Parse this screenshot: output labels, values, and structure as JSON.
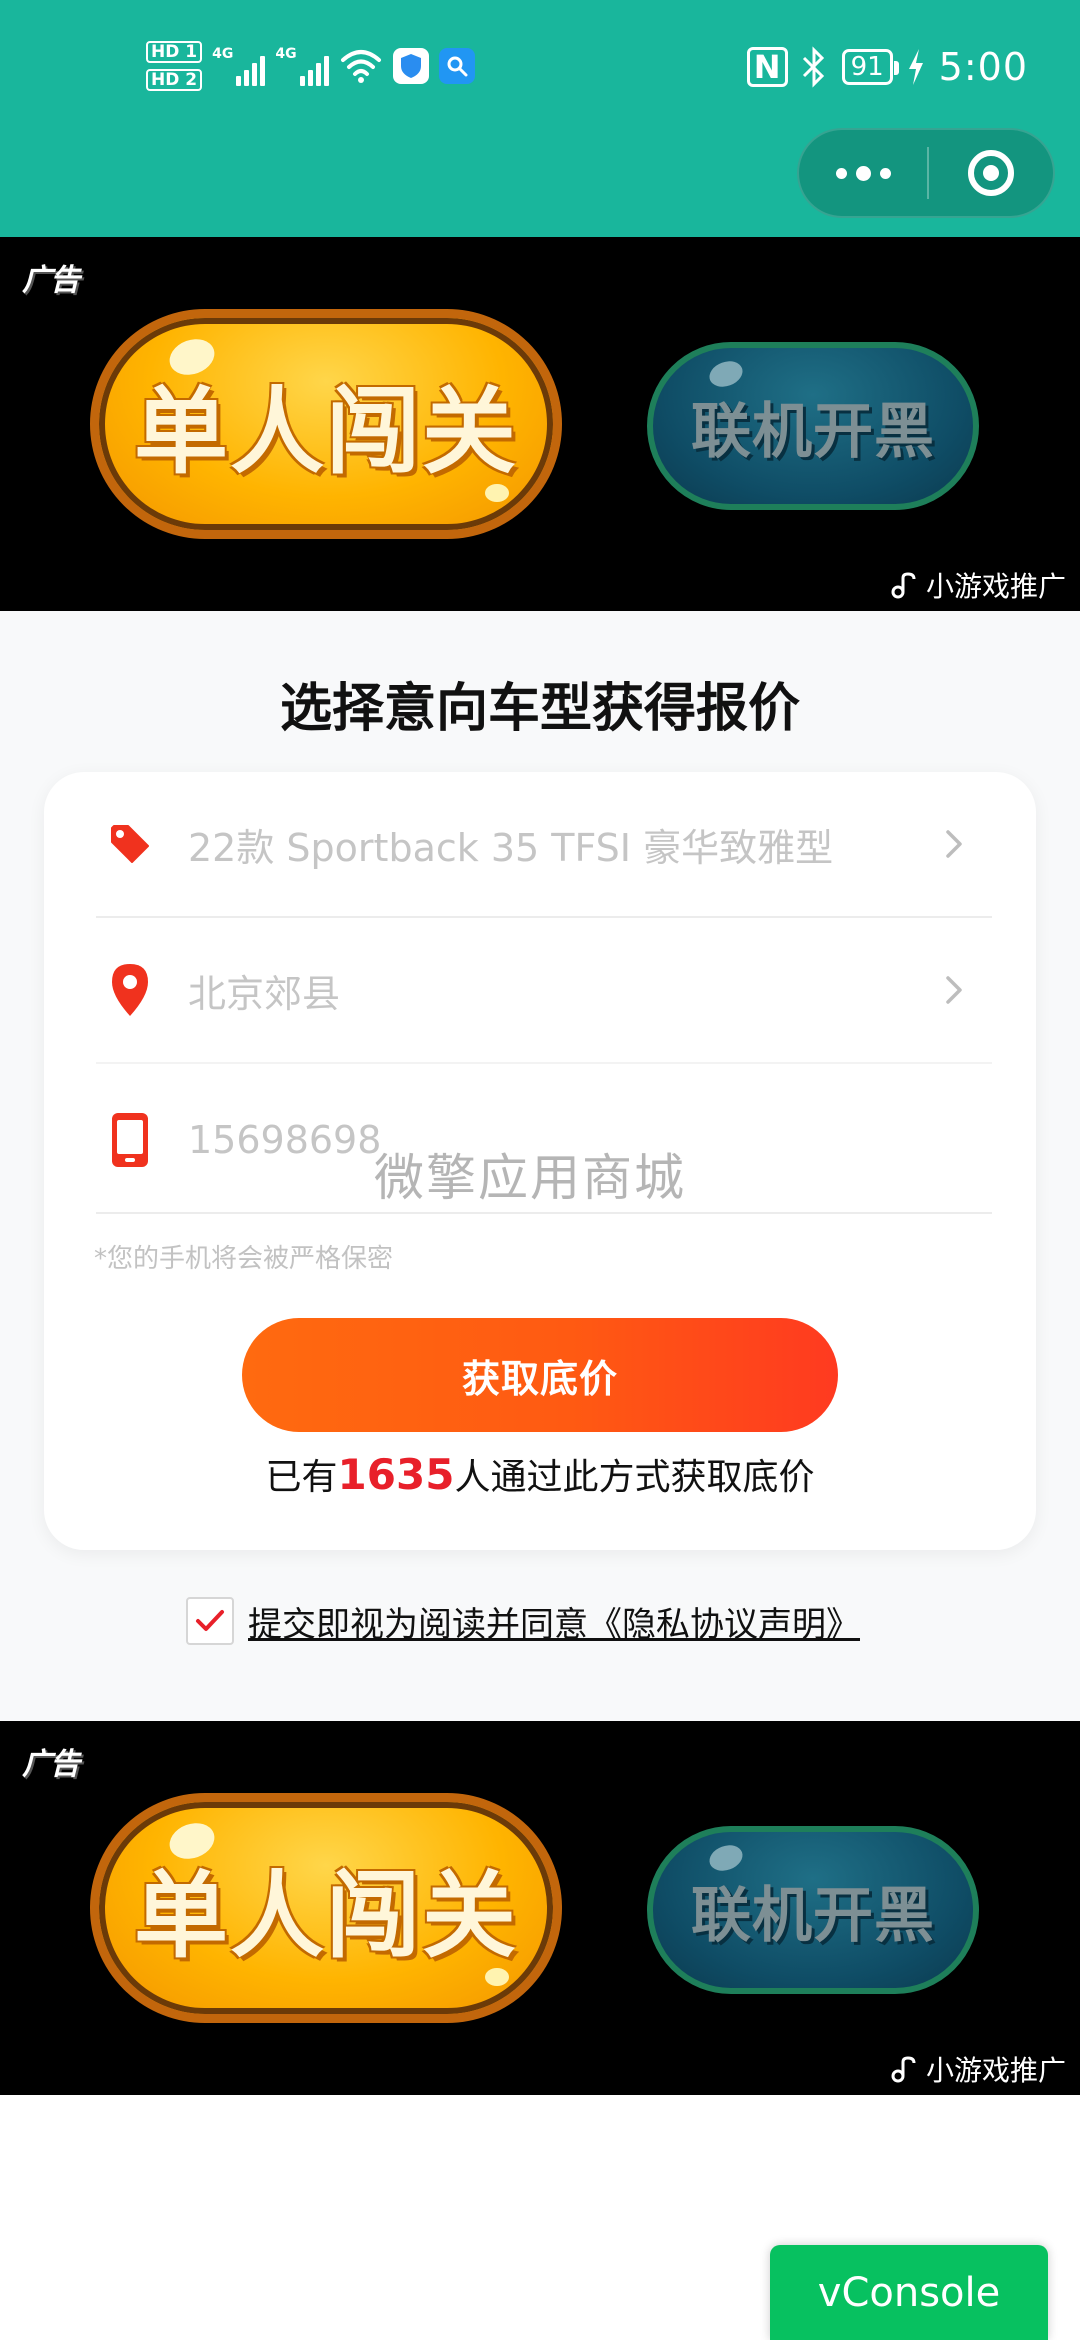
{
  "status_bar": {
    "hd1": "HD 1",
    "hd2": "HD 2",
    "net1": "4G",
    "net2": "4G",
    "nfc": "N",
    "battery": "91",
    "time": "5:00"
  },
  "ad": {
    "tag": "广告",
    "solo_label": "单人闯关",
    "coop_label": "联机开黑",
    "promo": "小游戏推广"
  },
  "page": {
    "title": "选择意向车型获得报价"
  },
  "form": {
    "car_model": "22款 Sportback 35 TFSI 豪华致雅型",
    "city": "北京郊县",
    "phone": "15698698",
    "phone_hint": "*您的手机将会被严格保密",
    "watermark": "微擎应用商城",
    "submit_label": "获取底价",
    "count_prefix": "已有",
    "count_value": "1635",
    "count_suffix": "人通过此方式获取底价"
  },
  "agreement": {
    "checked": true,
    "text": "提交即视为阅读并同意《隐私协议声明》"
  },
  "vconsole": {
    "label": "vConsole"
  },
  "colors": {
    "header": "#19b69c",
    "accent_orange": "#ff5a12",
    "count_red": "#e8202a",
    "vconsole_green": "#07c160"
  }
}
